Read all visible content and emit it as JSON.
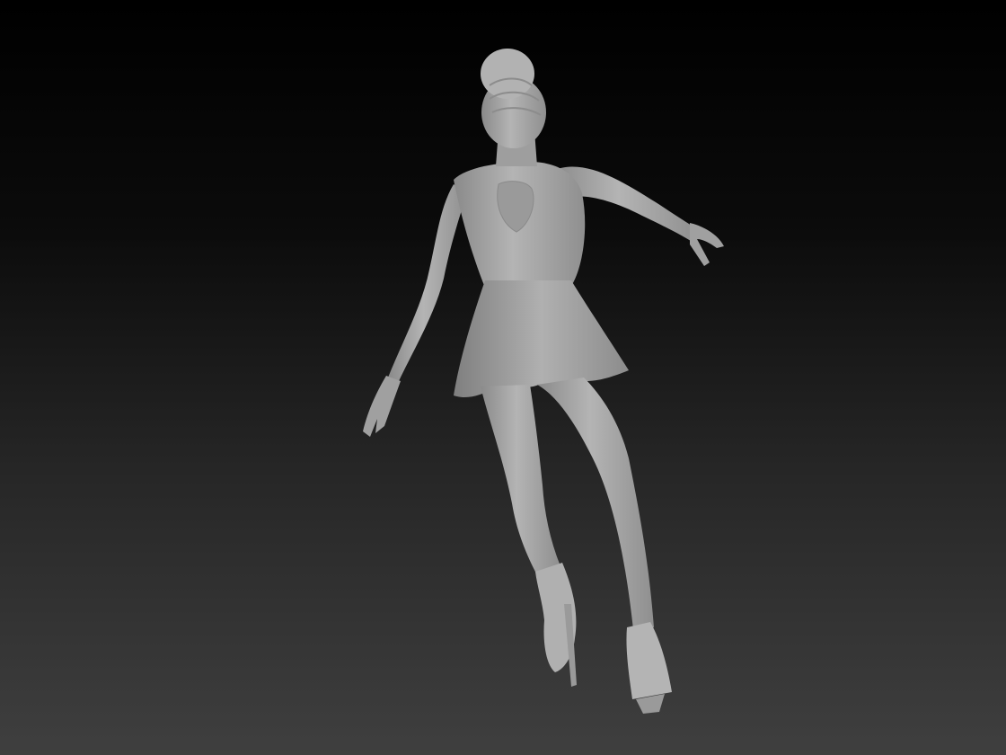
{
  "viewport": {
    "background_top": "#000000",
    "background_bottom": "#3f3f3f",
    "model_color": "#a8a8a8"
  }
}
